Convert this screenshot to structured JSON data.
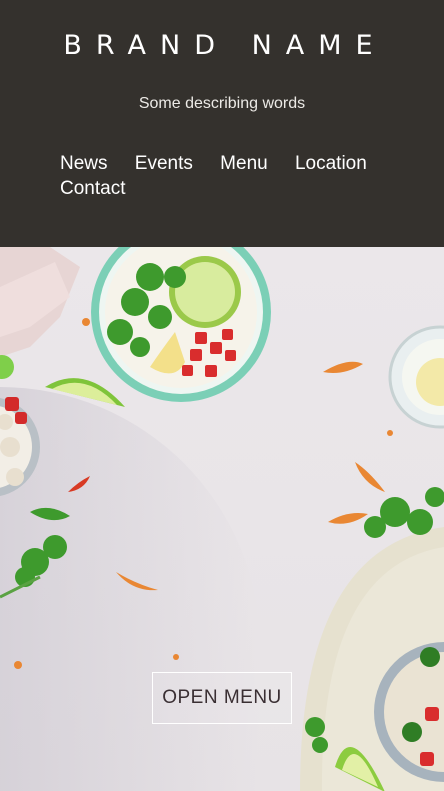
{
  "header": {
    "brand": "BRAND NAME",
    "tagline": "Some describing words"
  },
  "nav": {
    "items": [
      {
        "label": "News"
      },
      {
        "label": "Events"
      },
      {
        "label": "Menu"
      },
      {
        "label": "Location"
      },
      {
        "label": "Contact"
      }
    ]
  },
  "hero": {
    "cta_label": "OPEN MENU",
    "image": "food-table-photo"
  },
  "colors": {
    "header_bg": "#34312d",
    "header_text": "#ffffff",
    "hero_bg": "#ebe7ea",
    "cta_text": "#3a2f33"
  }
}
